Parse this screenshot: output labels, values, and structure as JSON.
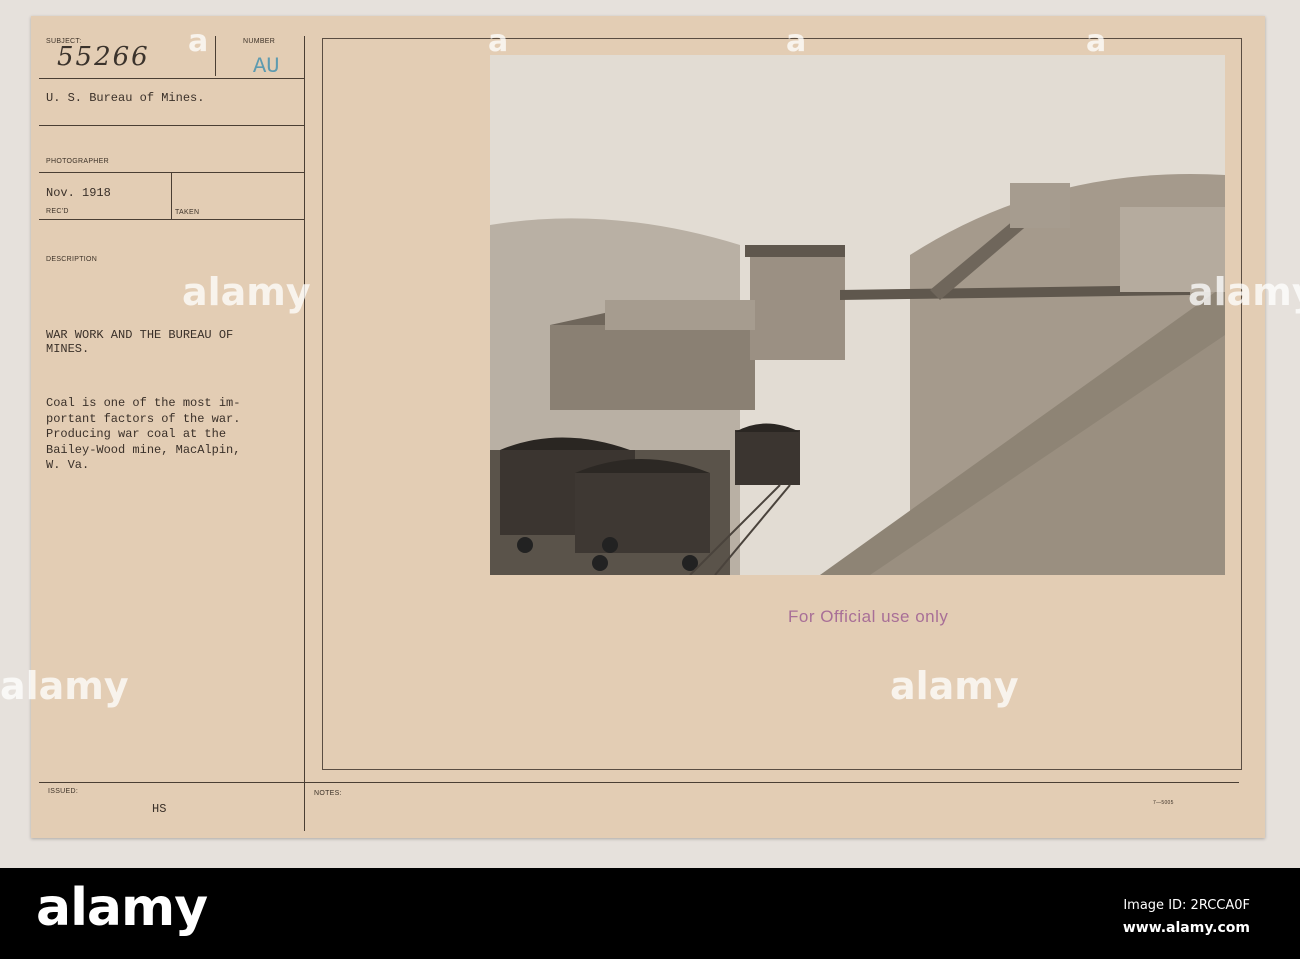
{
  "card": {
    "subject_label": "SUBJECT:",
    "subject_number": "55266",
    "number_label": "NUMBER",
    "number_stamp": "AU",
    "agency": "U. S. Bureau of Mines.",
    "photographer_label": "PHOTOGRAPHER",
    "received_date": "Nov. 1918",
    "recd_label": "REC'D",
    "taken_label": "TAKEN",
    "description_label": "DESCRIPTION",
    "title_lines": [
      "WAR WORK AND THE BUREAU OF",
      "MINES."
    ],
    "description_lines": [
      "Coal is one of the most im-",
      "portant factors of the war.",
      "Producing war coal at the",
      "Bailey-Wood mine, MacAlpin,",
      "W. Va."
    ],
    "issued_label": "ISSUED:",
    "issued_value": "HS",
    "notes_label": "NOTES:",
    "form_number": "7—5005",
    "stamp": "For Official use only"
  },
  "photo": {
    "icon": "coal-mine-tipple-photo"
  },
  "watermark": {
    "text": "a",
    "logo": "alamy"
  },
  "banner": {
    "logo": "alamy",
    "image_id": "Image ID: 2RCCA0F",
    "url": "www.alamy.com"
  }
}
